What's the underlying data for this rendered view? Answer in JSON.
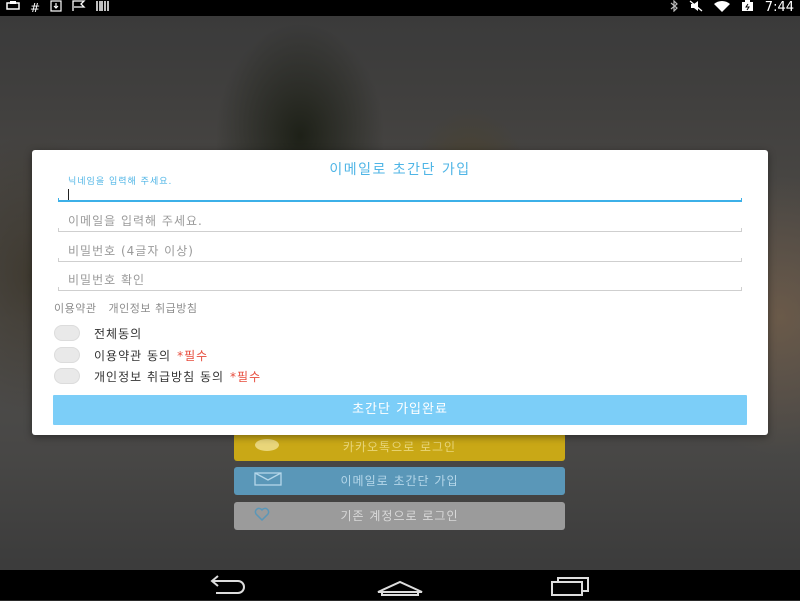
{
  "status_bar": {
    "left_icons": [
      "usb-icon",
      "hash-icon",
      "download-icon",
      "flag-icon",
      "barcode-icon"
    ],
    "right_icons": [
      "bluetooth-icon",
      "mute-icon",
      "wifi-icon",
      "battery-icon"
    ],
    "time": "7:44"
  },
  "background_buttons": {
    "kakao": "카카오톡으로 로그인",
    "email": "이메일로 초간단 가입",
    "existing": "기존 계정으로 로그인"
  },
  "dialog": {
    "title": "이메일로 초간단 가입",
    "fields": {
      "nickname": {
        "label": "닉네임을 입력해 주세요.",
        "value": ""
      },
      "email": {
        "placeholder": "이메일을 입력해 주세요."
      },
      "password": {
        "placeholder": "비밀번호 (4글자 이상)"
      },
      "password_confirm": {
        "placeholder": "비밀번호 확인"
      }
    },
    "terms_links": [
      "이용약관",
      "개인정보 취급방침"
    ],
    "checks": {
      "all": {
        "label": "전체동의"
      },
      "terms": {
        "label": "이용약관 동의",
        "required": "*필수"
      },
      "privacy": {
        "label": "개인정보 취급방침 동의",
        "required": "*필수"
      }
    },
    "submit_label": "초간단 가입완료"
  },
  "colors": {
    "accent": "#4fb5e6",
    "submit_bg": "#7ccef8",
    "required": "#e74c3c",
    "kakao_yellow": "#c9a816",
    "email_blue": "#5a97b8"
  }
}
